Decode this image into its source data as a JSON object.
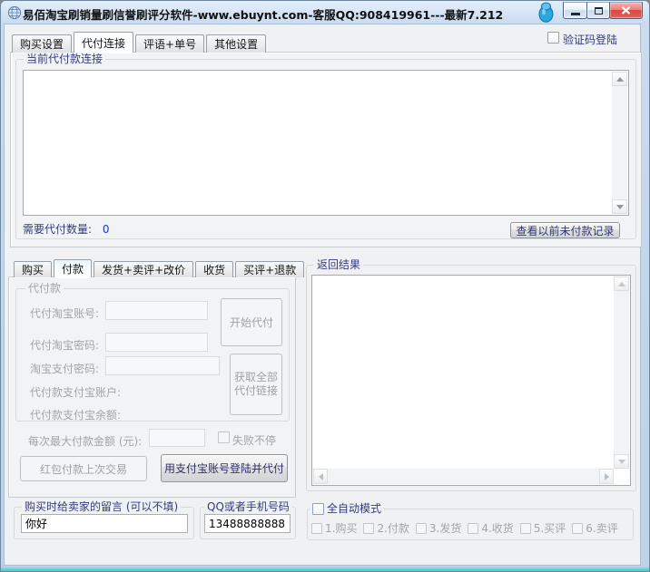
{
  "window": {
    "title": "易佰淘宝刷销量刷信誉刷评分软件-www.ebuynt.com-客服QQ:908419961---最新7.212"
  },
  "icons": {
    "app_icon": "globe",
    "gadget_icon": "blue-droplet",
    "minimize": "—",
    "maximize": "▢",
    "close": "✕"
  },
  "header": {
    "verify_checkbox_label": "验证码登陆"
  },
  "top_tabs": [
    {
      "label": "购买设置"
    },
    {
      "label": "代付连接"
    },
    {
      "label": "评语+单号"
    },
    {
      "label": "其他设置"
    }
  ],
  "link_section": {
    "group_title": "当前代付款连接",
    "textarea_value": "",
    "count_label": "需要代付数量:",
    "count_value": "0",
    "view_records_button": "查看以前未付款记录"
  },
  "lower_tabs": [
    {
      "label": "购买"
    },
    {
      "label": "付款"
    },
    {
      "label": "发货+卖评+改价"
    },
    {
      "label": "收货"
    },
    {
      "label": "买评+退款"
    }
  ],
  "payment_panel": {
    "group_title": "代付款",
    "account_label": "代付淘宝账号:",
    "account_value": "",
    "password_label": "代付淘宝密码:",
    "password_value": "",
    "pay_password_label": "淘宝支付密码:",
    "pay_password_value": "",
    "alipay_account_label": "代付款支付宝账户:",
    "alipay_balance_label": "代付款支付宝余额:",
    "start_button": "开始代付",
    "get_links_line1": "获取全部",
    "get_links_line2": "代付链接",
    "max_amount_label": "每次最大付款金额 (元):",
    "max_amount_value": "",
    "fail_nonstop_label": "失败不停",
    "redpacket_button": "红包付款上次交易",
    "alipay_login_button": "用支付宝账号登陆并代付"
  },
  "message_group": {
    "title": "购买时给卖家的留言 (可以不填)",
    "value": "你好"
  },
  "contact_group": {
    "title": "QQ或者手机号码",
    "value": "13488888888"
  },
  "result_section": {
    "group_title": "返回结果",
    "textarea_value": ""
  },
  "auto_mode": {
    "label": "全自动模式",
    "steps": [
      {
        "label": "1.购买"
      },
      {
        "label": "2.付款"
      },
      {
        "label": "3.发货"
      },
      {
        "label": "4.收货"
      },
      {
        "label": "5.买评"
      },
      {
        "label": "6.卖评"
      }
    ]
  },
  "colors": {
    "titlebar": "#c7daf0",
    "client_bg": "#f0f1f3",
    "group_label": "#333a82",
    "disabled_text": "#a3a4a6",
    "count_value": "#1738c6",
    "close_button": "#d6473f",
    "bottom_edge": "#3fd0ca"
  }
}
